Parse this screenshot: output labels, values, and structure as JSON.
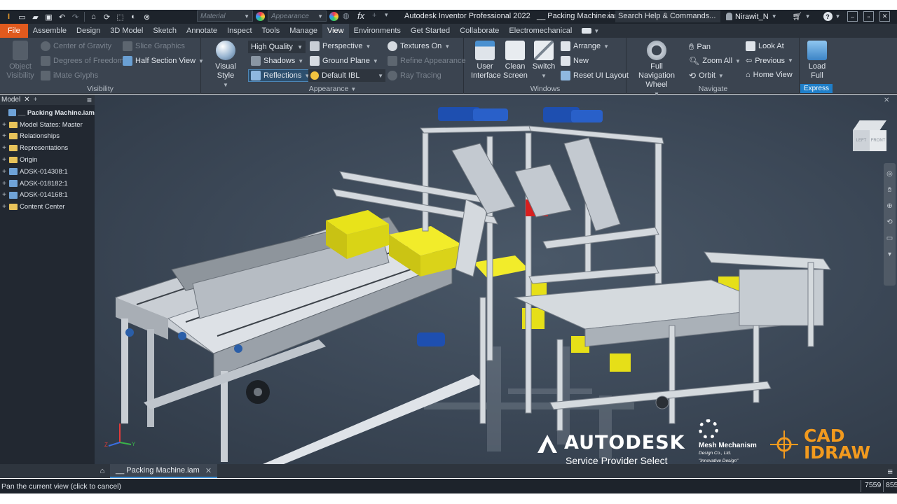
{
  "title_bar": {
    "app_title": "Autodesk Inventor Professional 2022",
    "document_title": "__ Packing Machine.iam",
    "search_placeholder": "Search Help & Commands...",
    "user_name": "Nirawit_N",
    "material_placeholder": "Material",
    "appearance_placeholder": "Appearance",
    "fx_label": "fx"
  },
  "tabs": [
    "File",
    "Assemble",
    "Design",
    "3D Model",
    "Sketch",
    "Annotate",
    "Inspect",
    "Tools",
    "Manage",
    "View",
    "Environments",
    "Get Started",
    "Collaborate",
    "Electromechanical"
  ],
  "active_tab": "View",
  "ribbon": {
    "visibility": {
      "title": "Visibility",
      "object_visibility": "Object Visibility",
      "center_of_gravity": "Center of Gravity",
      "degrees_of_freedom": "Degrees of Freedom",
      "imate_glyphs": "iMate Glyphs",
      "slice_graphics": "Slice Graphics",
      "half_section_view": "Half Section View"
    },
    "appearance": {
      "title": "Appearance",
      "visual_style": "Visual Style",
      "high_quality": "High Quality",
      "shadows": "Shadows",
      "reflections": "Reflections",
      "perspective": "Perspective",
      "ground_plane": "Ground Plane",
      "default_ibl": "Default IBL",
      "textures_on": "Textures On",
      "refine_appearance": "Refine Appearance",
      "ray_tracing": "Ray Tracing"
    },
    "windows": {
      "title": "Windows",
      "user_interface": "User Interface",
      "clean_screen": "Clean Screen",
      "switch": "Switch",
      "arrange": "Arrange",
      "new": "New",
      "reset_ui_layout": "Reset UI Layout"
    },
    "navigate": {
      "title": "Navigate",
      "full_navigation_wheel": "Full Navigation Wheel",
      "pan": "Pan",
      "zoom_all": "Zoom All",
      "orbit": "Orbit",
      "look_at": "Look At",
      "previous": "Previous",
      "home_view": "Home View"
    },
    "express": {
      "load_full": "Load Full",
      "badge": "Express"
    }
  },
  "browser": {
    "tab_label": "Model",
    "items": [
      {
        "label": "__ Packing Machine.iam",
        "type": "root"
      },
      {
        "label": "Model States: Master",
        "type": "folder"
      },
      {
        "label": "Relationships",
        "type": "folder"
      },
      {
        "label": "Representations",
        "type": "folder"
      },
      {
        "label": "Origin",
        "type": "folder"
      },
      {
        "label": "ADSK-014308:1",
        "type": "part"
      },
      {
        "label": "ADSK-018182:1",
        "type": "part"
      },
      {
        "label": "ADSK-014168:1",
        "type": "part"
      },
      {
        "label": "Content Center",
        "type": "folder"
      }
    ]
  },
  "viewport": {
    "viewcube_labels": [
      "LEFT",
      "FRONT"
    ],
    "axis_labels": [
      "X",
      "Y",
      "Z"
    ],
    "brand": {
      "autodesk": "AUTODESK",
      "service_provider": "Service Provider Select",
      "mesh_name": "Mesh Mechanism",
      "mesh_sub": "Design Co., Ltd.",
      "mesh_tagline": "\"Innovative Design\"",
      "cad_line1": "CAD",
      "cad_line2": "IDRAW"
    }
  },
  "document_tab": "__ Packing Machine.iam",
  "status": {
    "message": "Pan the current view (click to cancel)",
    "count1": "7559",
    "count2": "855"
  },
  "colors": {
    "file_tab": "#e05a1e",
    "ribbon": "#3b4450",
    "express_badge": "#1f7fc9",
    "cad_orange": "#f29a1e"
  }
}
